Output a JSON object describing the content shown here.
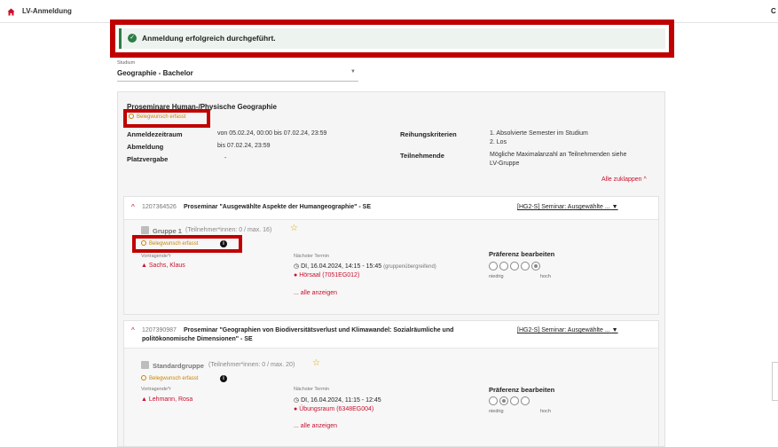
{
  "app": {
    "title": "LV-Anmeldung",
    "top_right": "C"
  },
  "alert": {
    "message": "Anmeldung erfolgreich durchgeführt."
  },
  "studium": {
    "label": "Studium",
    "value": "Geographie - Bachelor"
  },
  "course": {
    "title": "Proseminare Human-/Physische Geographie",
    "badge": "Belegwunsch erfasst",
    "anmeldezeitraum_label": "Anmeldezeitraum",
    "anmeldezeitraum": "von 05.02.24, 00:00 bis 07.02.24, 23:59",
    "abmeldung_label": "Abmeldung",
    "abmeldung": "bis 07.02.24, 23:59",
    "platzvergabe_label": "Platzvergabe",
    "platzvergabe": "-",
    "reihungskriterien_label": "Reihungskriterien",
    "reihungskriterien_1": "1. Absolvierte Semester im Studium",
    "reihungskriterien_2": "2. Los",
    "teilnehmende_label": "Teilnehmende",
    "teilnehmende_1": "Mögliche Maximalanzahl an Teilnehmenden siehe",
    "teilnehmende_2": "LV-Gruppe",
    "collapse_all": "Alle zuklappen"
  },
  "lvs": [
    {
      "number": "1207364526",
      "title": "Proseminar \"Ausgewählte Aspekte der Humangeographie\" - SE",
      "select": "[HG2-S] Seminar: Ausgewählte ...",
      "group_name": "Gruppe 1",
      "capacity": "(Teilnehmer*innen: 0 / max. 16)",
      "badge": "Belegwunsch erfasst",
      "lecturer_label": "Vortragende*r",
      "lecturer": "Sachs, Klaus",
      "next_label": "Nächster Termin",
      "next_date": "DI, 16.04.2024, 14:15 - 15:45",
      "next_aux": "(gruppenübergreifend)",
      "room": "Hörsaal (7051EG012)",
      "show_all": "... alle anzeigen",
      "pref_label": "Präferenz bearbeiten",
      "pref_low": "niedrig",
      "pref_high": "hoch",
      "pref_selected": 5
    },
    {
      "number": "1207390987",
      "title_1": "Proseminar \"Geographien von Biodiversitätsverlust und Klimawandel: Sozialräumliche und",
      "title_2": "politökonomische Dimensionen\" - SE",
      "select": "[HG2-S] Seminar: Ausgewählte ...",
      "group_name": "Standardgruppe",
      "capacity": "(Teilnehmer*innen: 0 / max. 20)",
      "badge": "Belegwunsch erfasst",
      "lecturer_label": "Vortragende*r",
      "lecturer": "Lehmann, Rosa",
      "next_label": "Nächster Termin",
      "next_date": "DI, 16.04.2024, 11:15 - 12:45",
      "room": "Übungsraum (6348EG004)",
      "show_all": "... alle anzeigen",
      "pref_label": "Präferenz bearbeiten",
      "pref_low": "niedrig",
      "pref_high": "hoch",
      "pref_selected": 2
    }
  ],
  "colors": {
    "accent": "#c8102e",
    "success": "#2e7d46",
    "warning": "#c98400",
    "highlight": "#c00000"
  }
}
